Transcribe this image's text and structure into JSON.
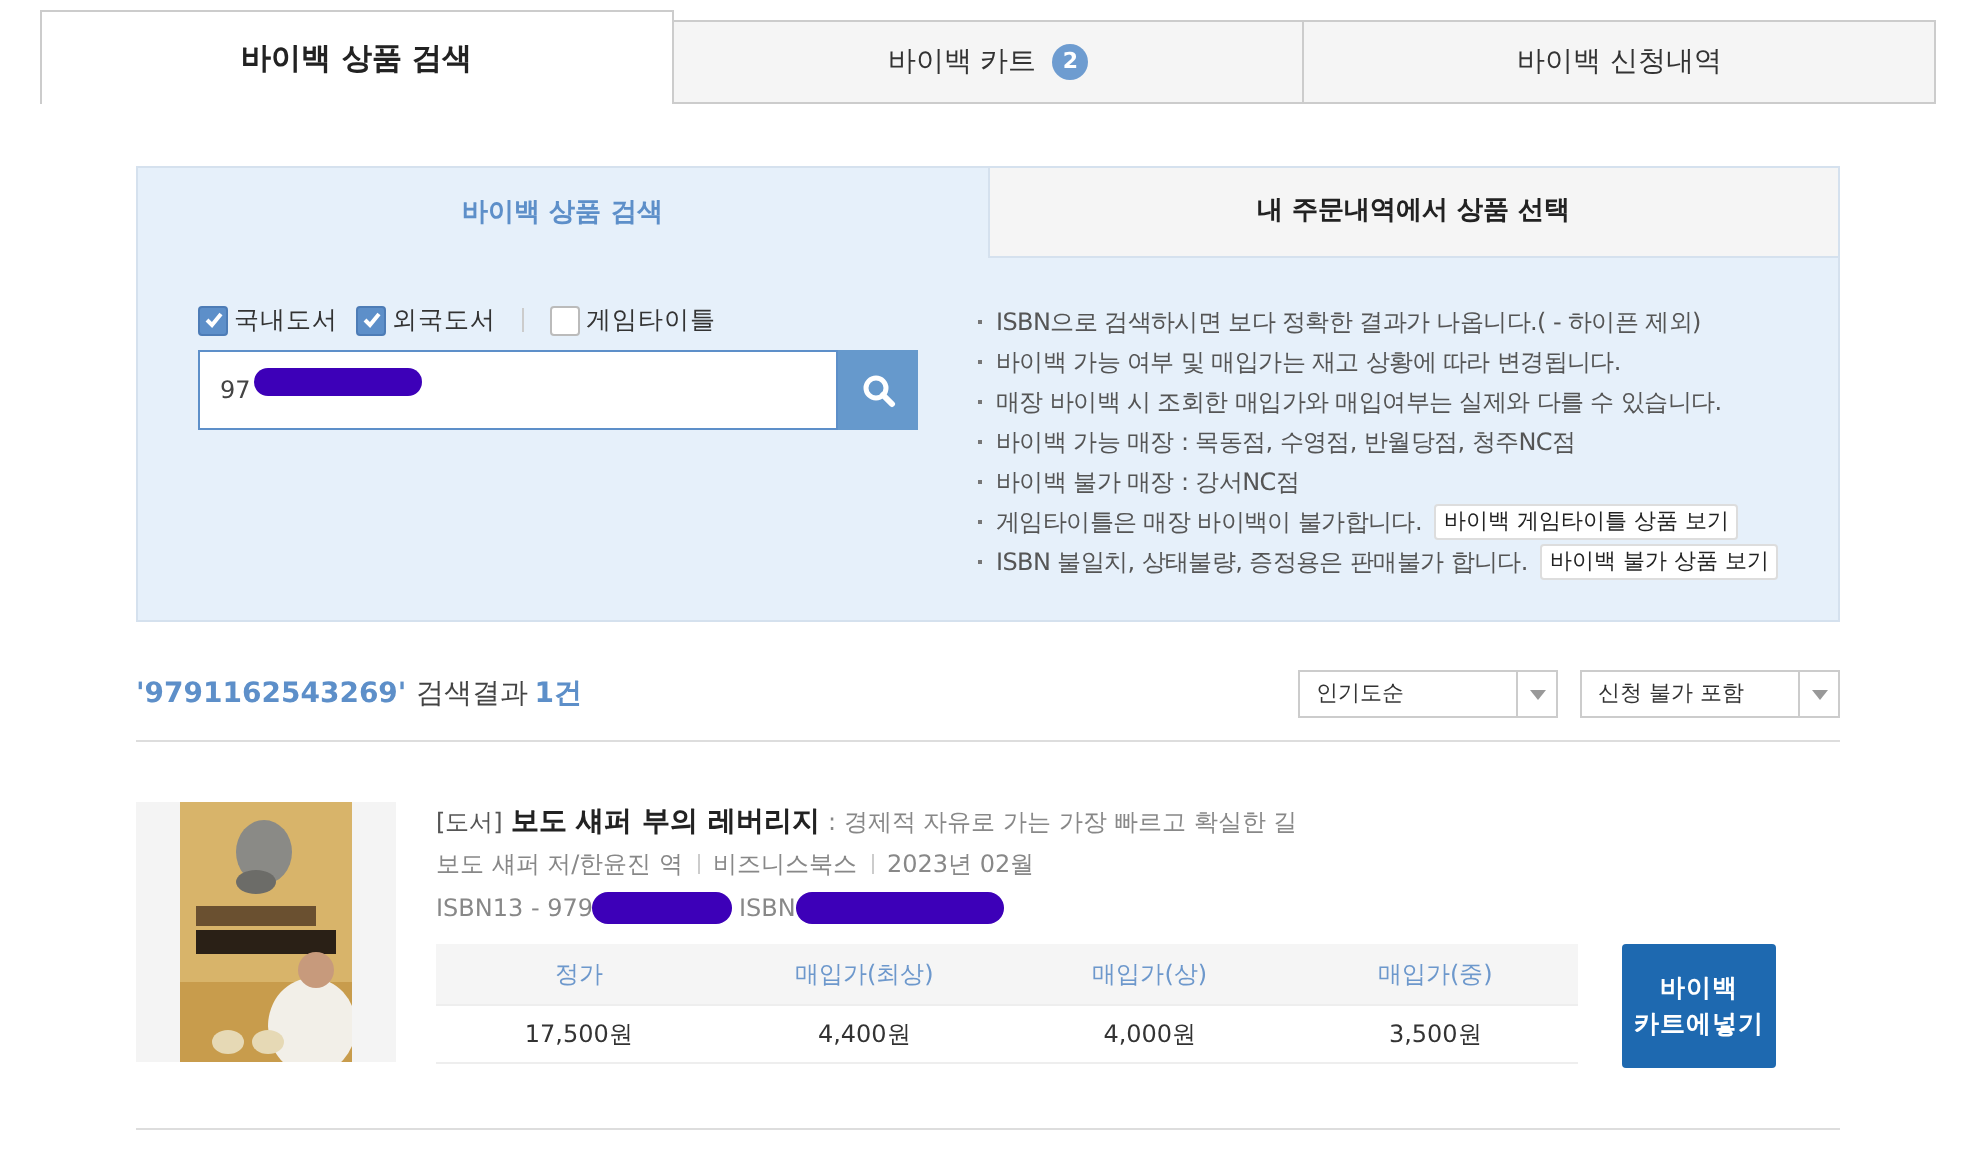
{
  "tabs": [
    {
      "label": "바이백 상품 검색",
      "selected": true
    },
    {
      "label": "바이백 카트",
      "badge": "2",
      "selected": false
    },
    {
      "label": "바이백 신청내역",
      "selected": false
    }
  ],
  "search_panel": {
    "tabs": [
      {
        "label": "바이백 상품 검색",
        "selected": true
      },
      {
        "label": "내 주문내역에서 상품 선택",
        "selected": false
      }
    ],
    "filters": [
      {
        "label": "국내도서",
        "checked": true
      },
      {
        "label": "외국도서",
        "checked": true
      },
      {
        "label": "게임타이틀",
        "checked": false
      }
    ],
    "search_value": "97",
    "notes": [
      {
        "text": "ISBN으로 검색하시면 보다 정확한 결과가 나옵니다.( - 하이픈 제외)"
      },
      {
        "text": "바이백 가능 여부 및 매입가는 재고 상황에 따라 변경됩니다."
      },
      {
        "text": "매장 바이백 시 조회한 매입가와 매입여부는 실제와 다를 수 있습니다."
      },
      {
        "text": "바이백 가능 매장 : 목동점, 수영점, 반월당점, 청주NC점"
      },
      {
        "text": "바이백 불가 매장 : 강서NC점"
      },
      {
        "text": "게임타이틀은 매장 바이백이 불가합니다.",
        "button": "바이백 게임타이틀 상품 보기"
      },
      {
        "text": "ISBN 불일치, 상태불량, 증정용은 판매불가 합니다.",
        "button": "바이백 불가 상품 보기"
      }
    ]
  },
  "results": {
    "query": "'9791162543269'",
    "label": "검색결과",
    "count": "1건",
    "sorts": [
      {
        "value": "인기도순"
      },
      {
        "value": "신청 불가 포함"
      }
    ]
  },
  "items": [
    {
      "cover": {
        "kind": "picture"
      },
      "category": "[도서]",
      "title": "보도 섀퍼 부의 레버리지",
      "subtitle": ": 경제적 자유로 가는 가장 빠르고 확실한 길",
      "meta": [
        "보도 섀퍼 저/한윤진 역",
        "비즈니스북스",
        "2023년 02월"
      ],
      "isbn13_label": "ISBN13 - 979",
      "isbn_label": "ISBN",
      "price_columns": [
        "정가",
        "매입가(최상)",
        "매입가(상)",
        "매입가(중)"
      ],
      "prices": [
        "17,500원",
        "4,400원",
        "4,000원",
        "3,500원"
      ],
      "button": "바이백\n카트에넣기"
    }
  ]
}
